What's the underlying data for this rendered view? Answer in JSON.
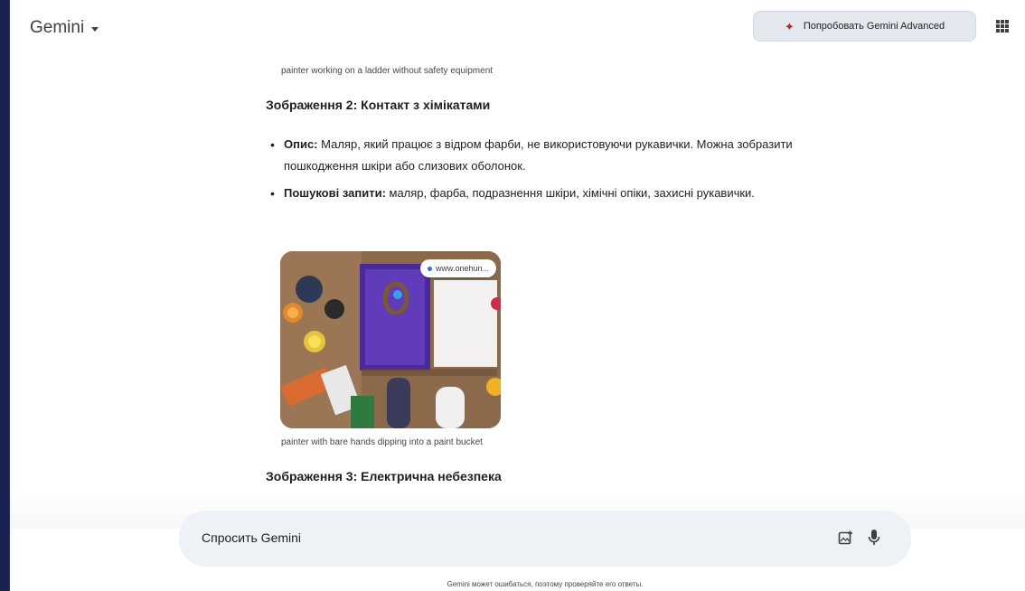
{
  "header": {
    "app_name": "Gemini",
    "try_button_label": "Попробовать Gemini Advanced"
  },
  "content": {
    "top_caption": "painter working on a ladder without safety equipment",
    "section2_title": "Зображення 2: Контакт з хімікатами",
    "bullets": [
      {
        "label": "Опис:",
        "text": " Маляр, який працює з відром фарби, не використовуючи рукавички. Можна зобразити пошкодження шкіри або слизових оболонок."
      },
      {
        "label": "Пошукові запити:",
        "text": " маляр, фарба, подразнення шкіри, хімічні опіки, захисні рукавички."
      }
    ],
    "image_source": "www.onehun...",
    "image_caption": "painter with bare hands dipping into a paint bucket",
    "section3_title": "Зображення 3: Електрична небезпека"
  },
  "input": {
    "placeholder": "Спросить Gemini"
  },
  "disclaimer": "Gemini может ошибаться, поэтому проверяйте его ответы.",
  "icons": {
    "try_button": "sparkle-icon",
    "apps": "apps-grid-icon",
    "add_image": "add-image-icon",
    "mic": "microphone-icon"
  },
  "colors": {
    "background": "#1a2150",
    "sparkle": "#c5221f",
    "input_bg": "#eef1f5"
  }
}
